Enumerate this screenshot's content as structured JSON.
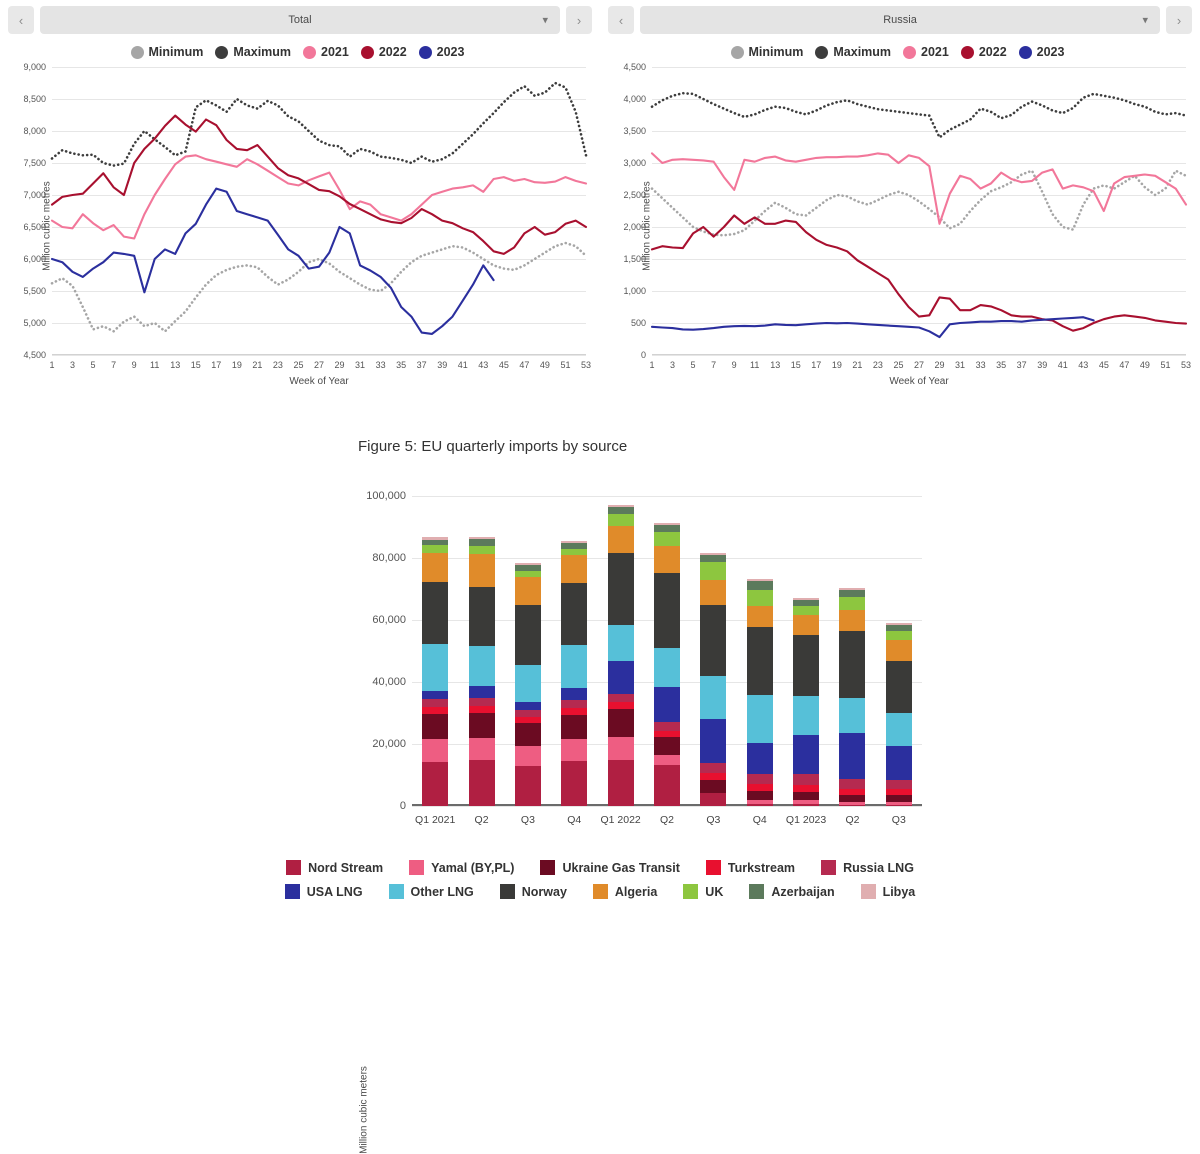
{
  "panels": [
    {
      "selector": {
        "value": "Total",
        "prev_icon": "chevron-left-icon",
        "next_icon": "chevron-right-icon",
        "caret_icon": "chevron-down-icon"
      },
      "legend": [
        {
          "label": "Minimum",
          "color": "#a6a6a6"
        },
        {
          "label": "Maximum",
          "color": "#3d3d3d"
        },
        {
          "label": "2021",
          "color": "#f2779a"
        },
        {
          "label": "2022",
          "color": "#a8102f"
        },
        {
          "label": "2023",
          "color": "#2b2f9e"
        }
      ],
      "chart_data": {
        "type": "line",
        "title": "",
        "xlabel": "Week of Year",
        "ylabel": "Million cubic metres",
        "ylim": [
          4500,
          9000
        ],
        "yticks": [
          4500,
          5000,
          5500,
          6000,
          6500,
          7000,
          7500,
          8000,
          8500,
          9000
        ],
        "xlim": [
          1,
          53
        ],
        "xticks": [
          1,
          3,
          5,
          7,
          9,
          11,
          13,
          15,
          17,
          19,
          21,
          23,
          25,
          27,
          29,
          31,
          33,
          35,
          37,
          39,
          41,
          43,
          45,
          47,
          49,
          51,
          53
        ],
        "grid": true,
        "legend_position": "top",
        "series": [
          {
            "name": "Minimum",
            "color": "#a6a6a6",
            "style": "dotted",
            "values": [
              5620,
              5700,
              5580,
              5250,
              4900,
              4950,
              4870,
              5020,
              5100,
              4950,
              5000,
              4870,
              5030,
              5180,
              5400,
              5600,
              5750,
              5830,
              5880,
              5900,
              5870,
              5720,
              5600,
              5680,
              5800,
              5950,
              6000,
              5930,
              5800,
              5700,
              5600,
              5520,
              5500,
              5620,
              5800,
              5950,
              6050,
              6100,
              6150,
              6200,
              6180,
              6100,
              6000,
              5900,
              5850,
              5830,
              5900,
              6000,
              6100,
              6200,
              6250,
              6200,
              6050
            ]
          },
          {
            "name": "Maximum",
            "color": "#3d3d3d",
            "style": "dotted",
            "values": [
              7570,
              7700,
              7650,
              7620,
              7630,
              7500,
              7460,
              7490,
              7800,
              8000,
              7870,
              7750,
              7620,
              7680,
              8370,
              8480,
              8400,
              8300,
              8500,
              8400,
              8350,
              8470,
              8400,
              8230,
              8150,
              8000,
              7850,
              7780,
              7760,
              7600,
              7720,
              7680,
              7600,
              7580,
              7550,
              7500,
              7600,
              7520,
              7560,
              7650,
              7800,
              7950,
              8120,
              8280,
              8450,
              8600,
              8700,
              8550,
              8600,
              8750,
              8680,
              8300,
              7620
            ]
          },
          {
            "name": "2021",
            "color": "#f2779a",
            "style": "solid",
            "values": [
              6600,
              6500,
              6480,
              6700,
              6560,
              6450,
              6530,
              6350,
              6320,
              6700,
              7000,
              7250,
              7480,
              7600,
              7620,
              7560,
              7520,
              7480,
              7440,
              7560,
              7480,
              7380,
              7280,
              7180,
              7150,
              7230,
              7290,
              7350,
              7080,
              6780,
              6900,
              6850,
              6700,
              6650,
              6600,
              6700,
              6850,
              7000,
              7050,
              7100,
              7120,
              7150,
              7050,
              7250,
              7280,
              7220,
              7250,
              7200,
              7190,
              7210,
              7280,
              7220,
              7180
            ]
          },
          {
            "name": "2022",
            "color": "#a8102f",
            "style": "solid",
            "values": [
              6850,
              6970,
              7000,
              7020,
              7180,
              7340,
              7120,
              7000,
              7500,
              7720,
              7880,
              8080,
              8240,
              8100,
              7990,
              8180,
              8090,
              7860,
              7720,
              7700,
              7780,
              7600,
              7420,
              7310,
              7260,
              7170,
              7080,
              7060,
              6980,
              6860,
              6780,
              6700,
              6620,
              6580,
              6560,
              6640,
              6780,
              6700,
              6600,
              6560,
              6480,
              6420,
              6280,
              6120,
              6080,
              6180,
              6400,
              6500,
              6380,
              6420,
              6550,
              6600,
              6500
            ]
          },
          {
            "name": "2023",
            "color": "#2b2f9e",
            "style": "solid",
            "values": [
              6000,
              5950,
              5800,
              5720,
              5850,
              5950,
              6100,
              6080,
              6050,
              5480,
              6000,
              6150,
              6080,
              6400,
              6550,
              6850,
              7100,
              7050,
              6750,
              6700,
              6650,
              6600,
              6380,
              6150,
              6050,
              5850,
              5880,
              6100,
              6500,
              6400,
              5900,
              5820,
              5720,
              5550,
              5250,
              5100,
              4850,
              4830,
              4950,
              5100,
              5350,
              5600,
              5900,
              5670,
              null,
              null,
              null,
              null,
              null,
              null,
              null,
              null,
              null
            ]
          }
        ]
      }
    },
    {
      "selector": {
        "value": "Russia",
        "prev_icon": "chevron-left-icon",
        "next_icon": "chevron-right-icon",
        "caret_icon": "chevron-down-icon"
      },
      "legend": [
        {
          "label": "Minimum",
          "color": "#a6a6a6"
        },
        {
          "label": "Maximum",
          "color": "#3d3d3d"
        },
        {
          "label": "2021",
          "color": "#f2779a"
        },
        {
          "label": "2022",
          "color": "#a8102f"
        },
        {
          "label": "2023",
          "color": "#2b2f9e"
        }
      ],
      "chart_data": {
        "type": "line",
        "title": "",
        "xlabel": "Week of Year",
        "ylabel": "Million cubic metres",
        "ylim": [
          0,
          4500
        ],
        "yticks": [
          0,
          500,
          1000,
          1500,
          2000,
          2500,
          3000,
          3500,
          4000,
          4500
        ],
        "xlim": [
          1,
          53
        ],
        "xticks": [
          1,
          3,
          5,
          7,
          9,
          11,
          13,
          15,
          17,
          19,
          21,
          23,
          25,
          27,
          29,
          31,
          33,
          35,
          37,
          39,
          41,
          43,
          45,
          47,
          49,
          51,
          53
        ],
        "grid": true,
        "legend_position": "top",
        "series": [
          {
            "name": "Minimum",
            "color": "#a6a6a6",
            "style": "dotted",
            "values": [
              2600,
              2450,
              2300,
              2150,
              2000,
              1930,
              1880,
              1870,
              1890,
              1950,
              2100,
              2250,
              2380,
              2300,
              2200,
              2180,
              2300,
              2420,
              2500,
              2480,
              2400,
              2350,
              2420,
              2500,
              2550,
              2500,
              2400,
              2280,
              2150,
              1980,
              2050,
              2250,
              2420,
              2560,
              2620,
              2700,
              2820,
              2880,
              2550,
              2200,
              2000,
              1960,
              2350,
              2600,
              2650,
              2600,
              2700,
              2800,
              2620,
              2500,
              2600,
              2880,
              2800
            ]
          },
          {
            "name": "Maximum",
            "color": "#3d3d3d",
            "style": "dotted",
            "values": [
              3880,
              3980,
              4050,
              4090,
              4080,
              4000,
              3920,
              3850,
              3780,
              3720,
              3760,
              3830,
              3880,
              3860,
              3800,
              3760,
              3820,
              3900,
              3950,
              3980,
              3920,
              3880,
              3840,
              3820,
              3800,
              3780,
              3760,
              3740,
              3400,
              3520,
              3600,
              3680,
              3850,
              3800,
              3700,
              3750,
              3880,
              3960,
              3900,
              3820,
              3780,
              3860,
              4020,
              4080,
              4050,
              4020,
              3980,
              3920,
              3880,
              3800,
              3760,
              3780,
              3740
            ]
          },
          {
            "name": "2021",
            "color": "#f2779a",
            "style": "solid",
            "values": [
              3150,
              3000,
              3050,
              3060,
              3050,
              3040,
              3020,
              2780,
              2580,
              3050,
              3020,
              3080,
              3100,
              3040,
              3020,
              3050,
              3080,
              3090,
              3090,
              3100,
              3100,
              3120,
              3150,
              3130,
              3000,
              3120,
              3080,
              2950,
              2050,
              2520,
              2800,
              2750,
              2600,
              2680,
              2850,
              2750,
              2700,
              2720,
              2850,
              2900,
              2600,
              2650,
              2620,
              2560,
              2250,
              2680,
              2780,
              2800,
              2820,
              2800,
              2700,
              2600,
              2350
            ]
          },
          {
            "name": "2022",
            "color": "#a8102f",
            "style": "solid",
            "values": [
              1650,
              1700,
              1680,
              1670,
              1900,
              2000,
              1850,
              2000,
              2180,
              2050,
              2150,
              2050,
              2050,
              2100,
              2080,
              1920,
              1800,
              1720,
              1680,
              1620,
              1480,
              1380,
              1280,
              1180,
              950,
              750,
              600,
              620,
              900,
              880,
              700,
              700,
              780,
              760,
              700,
              620,
              600,
              600,
              560,
              540,
              450,
              380,
              420,
              500,
              560,
              600,
              620,
              600,
              580,
              540,
              520,
              500,
              490
            ]
          },
          {
            "name": "2023",
            "color": "#2b2f9e",
            "style": "solid",
            "values": [
              440,
              430,
              420,
              400,
              395,
              405,
              420,
              440,
              450,
              455,
              450,
              460,
              480,
              470,
              465,
              480,
              490,
              500,
              495,
              500,
              490,
              480,
              470,
              460,
              450,
              440,
              430,
              370,
              280,
              480,
              500,
              510,
              520,
              520,
              530,
              530,
              520,
              540,
              550,
              560,
              570,
              580,
              590,
              540,
              null,
              null,
              null,
              null,
              null,
              null,
              null,
              null,
              null
            ]
          }
        ]
      }
    }
  ],
  "figure5": {
    "title": "Figure 5: EU quarterly imports by source",
    "chart_data": {
      "type": "bar",
      "stacked": true,
      "title": "Figure 5: EU quarterly imports by source",
      "xlabel": "",
      "ylabel": "Million cubic meters",
      "ylim": [
        0,
        100000
      ],
      "yticks": [
        0,
        20000,
        40000,
        60000,
        80000,
        100000
      ],
      "grid": true,
      "legend_position": "bottom",
      "categories": [
        "Q1 2021",
        "Q2",
        "Q3",
        "Q4",
        "Q1 2022",
        "Q2",
        "Q3",
        "Q4",
        "Q1 2023",
        "Q2",
        "Q3"
      ],
      "series": [
        {
          "name": "Nord Stream",
          "color": "#b01f42",
          "values": [
            14300,
            14700,
            12800,
            14600,
            14900,
            13100,
            4300,
            500,
            500,
            400,
            400
          ]
        },
        {
          "name": "Yamal (BY,PL)",
          "color": "#ee5d82",
          "values": [
            7200,
            7300,
            6600,
            7100,
            7300,
            3400,
            0,
            1500,
            1400,
            900,
            900
          ]
        },
        {
          "name": "Ukraine Gas Transit",
          "color": "#6b0b22",
          "values": [
            8200,
            8100,
            7400,
            7800,
            9100,
            5800,
            4100,
            2700,
            2600,
            2200,
            2100
          ]
        },
        {
          "name": "Turkstream",
          "color": "#e8102f",
          "values": [
            2100,
            2200,
            1900,
            2100,
            2200,
            2000,
            2100,
            2300,
            2300,
            2100,
            2000
          ]
        },
        {
          "name": "Russia LNG",
          "color": "#b52a50",
          "values": [
            2600,
            2700,
            2400,
            2600,
            2700,
            2700,
            3500,
            3300,
            3400,
            3100,
            3000
          ]
        },
        {
          "name": "USA LNG",
          "color": "#2b2f9e",
          "values": [
            2800,
            3700,
            2600,
            4000,
            10700,
            11500,
            14200,
            10000,
            12800,
            14800,
            11000
          ]
        },
        {
          "name": "Other LNG",
          "color": "#56c0d8",
          "values": [
            15000,
            12900,
            11800,
            13600,
            11600,
            12600,
            13800,
            15500,
            12400,
            11500,
            10500
          ]
        },
        {
          "name": "Norway",
          "color": "#3a3a38",
          "values": [
            20000,
            19200,
            19300,
            20200,
            23200,
            24200,
            22900,
            21800,
            19800,
            21500,
            17000
          ]
        },
        {
          "name": "Algeria",
          "color": "#e08b2a",
          "values": [
            9500,
            10400,
            9000,
            9000,
            8700,
            8500,
            8000,
            7000,
            6400,
            6700,
            6600
          ]
        },
        {
          "name": "UK",
          "color": "#8dc63f",
          "values": [
            2400,
            2600,
            2000,
            1800,
            3800,
            4600,
            5700,
            5200,
            3000,
            4100,
            2900
          ]
        },
        {
          "name": "Azerbaijan",
          "color": "#5c7a5c",
          "values": [
            1800,
            2200,
            2000,
            2000,
            2200,
            2200,
            2400,
            2700,
            1800,
            2500,
            2100
          ]
        },
        {
          "name": "Libya",
          "color": "#e0aeb0",
          "values": [
            900,
            800,
            700,
            700,
            800,
            800,
            700,
            700,
            700,
            700,
            700
          ]
        }
      ]
    }
  }
}
